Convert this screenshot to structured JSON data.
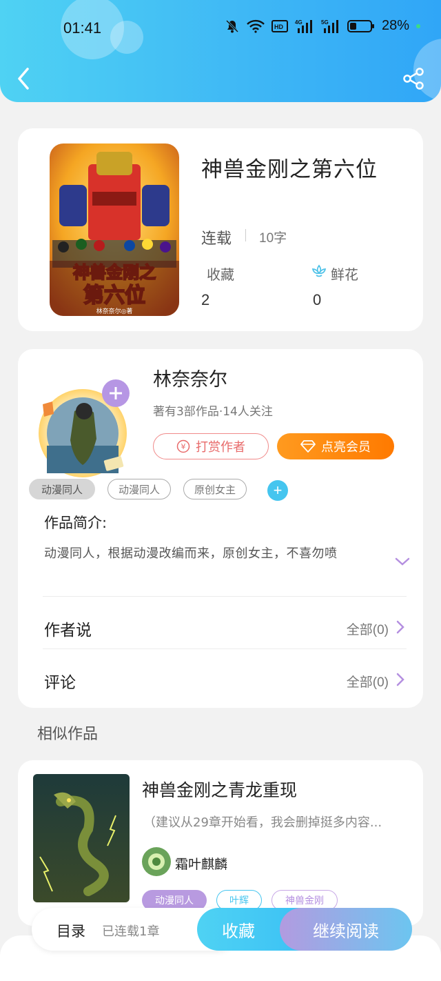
{
  "status_bar": {
    "time": "01:41",
    "battery": "28%",
    "indicators": [
      "mute-icon",
      "wifi-icon",
      "hd-icon",
      "4g-signal-icon",
      "5g-signal-icon",
      "battery-icon"
    ]
  },
  "header": {
    "back_icon": "chevron-left-icon",
    "share_icon": "share-icon",
    "accent_gradient": [
      "#4fd2f3",
      "#30a6f7"
    ]
  },
  "book": {
    "title": "神兽金刚之第六位",
    "status": "连载",
    "word_count": "10字",
    "cover_text_line1": "神兽金刚之",
    "cover_text_line2": "第六位",
    "cover_author": "林奈奈尔◎著",
    "stats": {
      "collect_label": "收藏",
      "collect_value": "2",
      "flower_label": "鲜花",
      "flower_value": "0"
    }
  },
  "author": {
    "name": "林奈奈尔",
    "meta": "著有3部作品·14人关注",
    "tip_label": "打赏作者",
    "vip_label": "点亮会员",
    "tags": [
      "动漫同人",
      "动漫同人",
      "原创女主"
    ],
    "intro_label": "作品简介:",
    "intro_text": "动漫同人，根据动漫改编而来，原创女主，不喜勿喷",
    "rows": [
      {
        "label": "作者说",
        "right": "全部(0)"
      },
      {
        "label": "评论",
        "right": "全部(0)"
      }
    ]
  },
  "similar": {
    "section_title": "相似作品",
    "items": [
      {
        "title": "神兽金刚之青龙重现",
        "desc": "（建议从29章开始看，我会删掉挺多内容...",
        "author": "霜叶麒麟",
        "tags": [
          {
            "label": "动漫同人",
            "color": "#b89ae0",
            "filled": true
          },
          {
            "label": "叶辉",
            "color": "#45c5ef",
            "filled": false
          },
          {
            "label": "神兽金刚",
            "color": "#c7a7e6",
            "filled": false
          }
        ]
      }
    ]
  },
  "bottom": {
    "toc_label": "目录",
    "toc_count": "已连载1章",
    "collect_label": "收藏",
    "read_label": "继续阅读"
  }
}
